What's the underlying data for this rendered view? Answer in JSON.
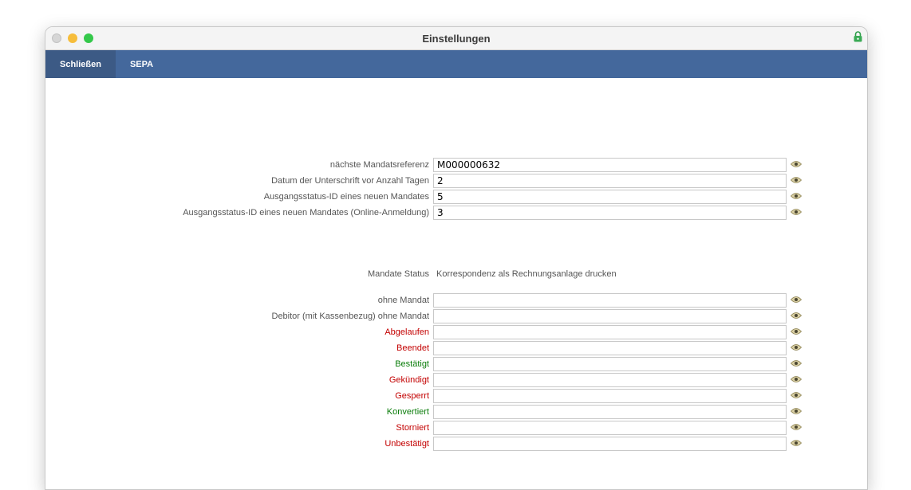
{
  "window": {
    "title": "Einstellungen"
  },
  "toolbar": {
    "close_label": "Schließen",
    "sepa_label": "SEPA"
  },
  "settings": [
    {
      "label": "nächste Mandatsreferenz",
      "value": "M000000632"
    },
    {
      "label": "Datum der Unterschrift vor Anzahl Tagen",
      "value": "2"
    },
    {
      "label": "Ausgangsstatus-ID eines neuen Mandates",
      "value": "5"
    },
    {
      "label": "Ausgangsstatus-ID eines neuen Mandates (Online-Anmeldung)",
      "value": "3"
    }
  ],
  "mandate_header": {
    "label": "Mandate Status",
    "value": "Korrespondenz als Rechnungsanlage drucken"
  },
  "mandate_rows": [
    {
      "label": "ohne Mandat",
      "value": "",
      "color": "#555555"
    },
    {
      "label": "Debitor (mit Kassenbezug) ohne Mandat",
      "value": "",
      "color": "#555555"
    },
    {
      "label": "Abgelaufen",
      "value": "",
      "color": "#c30000"
    },
    {
      "label": "Beendet",
      "value": "",
      "color": "#c30000"
    },
    {
      "label": "Bestätigt",
      "value": "",
      "color": "#0b7d0b"
    },
    {
      "label": "Gekündigt",
      "value": "",
      "color": "#c30000"
    },
    {
      "label": "Gesperrt",
      "value": "",
      "color": "#c30000"
    },
    {
      "label": "Konvertiert",
      "value": "",
      "color": "#0b7d0b"
    },
    {
      "label": "Storniert",
      "value": "",
      "color": "#c30000"
    },
    {
      "label": "Unbestätigt",
      "value": "",
      "color": "#c30000"
    }
  ],
  "colors": {
    "toolbar": "#44689c",
    "toolbar_active": "#3c5a85",
    "red_status": "#c30000",
    "green_status": "#0b7d0b"
  }
}
